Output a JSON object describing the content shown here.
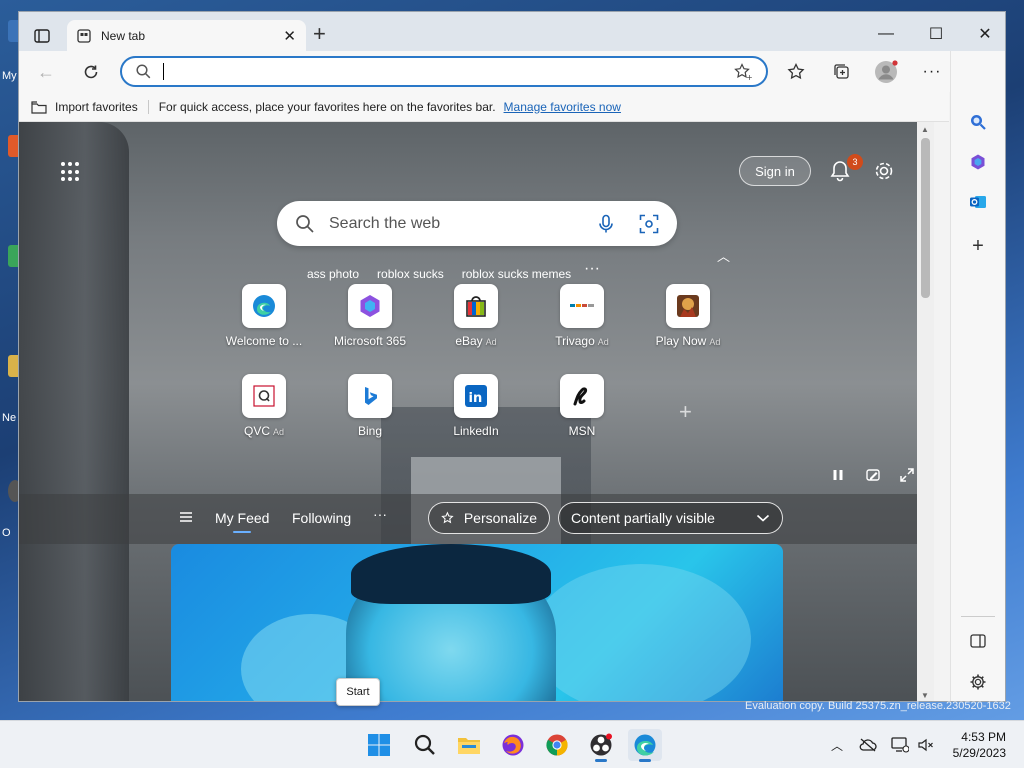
{
  "desktop": {
    "labels": [
      "My",
      "Ne",
      "O"
    ]
  },
  "window": {
    "tab": {
      "title": "New tab"
    },
    "controls": {
      "minimize": "—",
      "maximize": "☐",
      "close": "✕"
    }
  },
  "omnibox": {
    "placeholder": "",
    "value": ""
  },
  "favorites_bar": {
    "import_label": "Import favorites",
    "message": "For quick access, place your favorites here on the favorites bar.",
    "manage_link": "Manage favorites now"
  },
  "newtab": {
    "signin_label": "Sign in",
    "notification_count": "3",
    "search_placeholder": "Search the web",
    "suggestions": [
      "ass photo",
      "roblox sucks",
      "roblox sucks memes"
    ],
    "suggestions_more": "···",
    "tiles": [
      {
        "label": "Welcome to ...",
        "ad": "",
        "icon": "edge-logo-icon"
      },
      {
        "label": "Microsoft 365",
        "ad": "",
        "icon": "microsoft365-icon"
      },
      {
        "label": "eBay",
        "ad": "Ad",
        "icon": "ebay-bag-icon"
      },
      {
        "label": "Trivago",
        "ad": "Ad",
        "icon": "trivago-icon"
      },
      {
        "label": "Play Now",
        "ad": "Ad",
        "icon": "game-thumbnail-icon"
      },
      {
        "label": "QVC",
        "ad": "Ad",
        "icon": "qvc-icon"
      },
      {
        "label": "Bing",
        "ad": "",
        "icon": "bing-icon"
      },
      {
        "label": "LinkedIn",
        "ad": "",
        "icon": "linkedin-icon"
      },
      {
        "label": "MSN",
        "ad": "",
        "icon": "msn-icon"
      }
    ],
    "feed": {
      "tabs": [
        "My Feed",
        "Following"
      ],
      "more": "···",
      "personalize_label": "Personalize",
      "visibility_label": "Content partially visible"
    }
  },
  "tooltip": {
    "text": "Start"
  },
  "watermark": "Evaluation copy. Build 25375.zn_release.230520-1632",
  "taskbar": {
    "apps": [
      "windows-start-icon",
      "search-icon",
      "file-explorer-icon",
      "firefox-icon",
      "chrome-icon",
      "obs-icon",
      "edge-icon"
    ],
    "time": "4:53 PM",
    "date": "5/29/2023"
  },
  "colors": {
    "accent": "#2a78c8",
    "link": "#1a64b8",
    "badge": "#d04b1b"
  }
}
